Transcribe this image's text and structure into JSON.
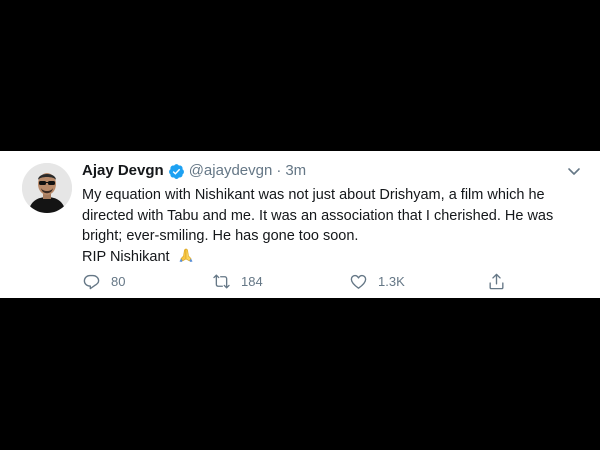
{
  "tweet": {
    "author": {
      "display_name": "Ajay Devgn",
      "handle": "@ajaydevgn",
      "verified": true
    },
    "separator": "·",
    "timestamp": "3m",
    "text_lines": [
      "My equation with Nishikant was not just about Drishyam, a film which he directed with Tabu and me. It was an association that I cherished. He was bright; ever-smiling. He has gone too soon.",
      "RIP Nishikant"
    ],
    "emoji": "folded-hands",
    "actions": {
      "reply": {
        "icon": "reply-icon",
        "count": "80"
      },
      "retweet": {
        "icon": "retweet-icon",
        "count": "184"
      },
      "like": {
        "icon": "heart-icon",
        "count": "1.3K"
      },
      "share": {
        "icon": "share-icon"
      }
    }
  },
  "colors": {
    "background": "#000000",
    "card": "#ffffff",
    "text": "#14171a",
    "secondary": "#657786",
    "verified": "#1da1f2"
  }
}
